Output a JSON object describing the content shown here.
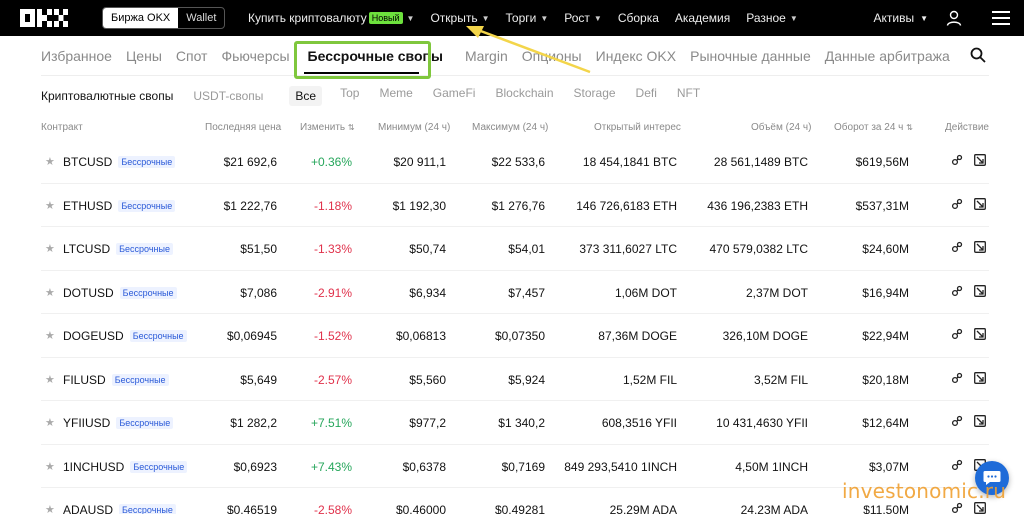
{
  "nav": {
    "logo": "OKX",
    "switch": {
      "exchange": "Биржа OKX",
      "wallet": "Wallet"
    },
    "items": [
      {
        "label": "Купить криптовалюту",
        "badge": "Новый",
        "chevron": true
      },
      {
        "label": "Открыть",
        "chevron": true
      },
      {
        "label": "Торги",
        "chevron": true
      },
      {
        "label": "Рост",
        "chevron": true
      },
      {
        "label": "Сборка",
        "chevron": false
      },
      {
        "label": "Академия",
        "chevron": false
      },
      {
        "label": "Разное",
        "chevron": true
      }
    ],
    "assets": "Активы"
  },
  "category_tabs": [
    "Избранное",
    "Цены",
    "Спот",
    "Фьючерсы",
    "Бессрочные свопы",
    "Margin",
    "Опционы",
    "Индекс OKX",
    "Рыночные данные",
    "Данные арбитража"
  ],
  "active_category": "Бессрочные свопы",
  "sub_tabs": {
    "primary": "Криптовалютные свопы",
    "secondary": "USDT-свопы",
    "filters": [
      "Все",
      "Top",
      "Meme",
      "GameFi",
      "Blockchain",
      "Storage",
      "Defi",
      "NFT"
    ],
    "active_filter": "Все"
  },
  "table": {
    "headers": {
      "contract": "Контракт",
      "last_price": "Последняя цена",
      "change": "Изменить",
      "low": "Минимум (24 ч)",
      "high": "Максимум (24 ч)",
      "oi": "Открытый интерес",
      "volume": "Объём (24 ч)",
      "turnover": "Оборот за 24 ч",
      "action": "Действие"
    },
    "sort_icon": "sort-arrows-icon",
    "tag_label": "Бессрочные",
    "rows": [
      {
        "symbol": "BTCUSD",
        "price": "$21 692,6",
        "change": "+0.36%",
        "dir": "pos",
        "low": "$20 911,1",
        "high": "$22 533,6",
        "oi": "18 454,1841 BTC",
        "volume": "28 561,1489 BTC",
        "turnover": "$619,56M"
      },
      {
        "symbol": "ETHUSD",
        "price": "$1 222,76",
        "change": "-1.18%",
        "dir": "neg",
        "low": "$1 192,30",
        "high": "$1 276,76",
        "oi": "146 726,6183 ETH",
        "volume": "436 196,2383 ETH",
        "turnover": "$537,31M"
      },
      {
        "symbol": "LTCUSD",
        "price": "$51,50",
        "change": "-1.33%",
        "dir": "neg",
        "low": "$50,74",
        "high": "$54,01",
        "oi": "373 311,6027 LTC",
        "volume": "470 579,0382 LTC",
        "turnover": "$24,60M"
      },
      {
        "symbol": "DOTUSD",
        "price": "$7,086",
        "change": "-2.91%",
        "dir": "neg",
        "low": "$6,934",
        "high": "$7,457",
        "oi": "1,06M DOT",
        "volume": "2,37M DOT",
        "turnover": "$16,94M"
      },
      {
        "symbol": "DOGEUSD",
        "price": "$0,06945",
        "change": "-1.52%",
        "dir": "neg",
        "low": "$0,06813",
        "high": "$0,07350",
        "oi": "87,36M DOGE",
        "volume": "326,10M DOGE",
        "turnover": "$22,94M"
      },
      {
        "symbol": "FILUSD",
        "price": "$5,649",
        "change": "-2.57%",
        "dir": "neg",
        "low": "$5,560",
        "high": "$5,924",
        "oi": "1,52M FIL",
        "volume": "3,52M FIL",
        "turnover": "$20,18M"
      },
      {
        "symbol": "YFIIUSD",
        "price": "$1 282,2",
        "change": "+7.51%",
        "dir": "pos",
        "low": "$977,2",
        "high": "$1 340,2",
        "oi": "608,3516 YFII",
        "volume": "10 431,4630 YFII",
        "turnover": "$12,64M"
      },
      {
        "symbol": "1INCHUSD",
        "price": "$0,6923",
        "change": "+7.43%",
        "dir": "pos",
        "low": "$0,6378",
        "high": "$0,7169",
        "oi": "849 293,5410 1INCH",
        "volume": "4,50M 1INCH",
        "turnover": "$3,07M"
      },
      {
        "symbol": "ADAUSD",
        "price": "$0,46519",
        "change": "-2.58%",
        "dir": "neg",
        "low": "$0,46000",
        "high": "$0,49281",
        "oi": "25,29M ADA",
        "volume": "24,23M ADA",
        "turnover": "$11,50M"
      }
    ]
  },
  "watermark": "investonomic.ru",
  "colors": {
    "positive": "#26a65b",
    "negative": "#e0314b",
    "highlight": "#7fc73d",
    "arrow": "#f3d54a",
    "chat": "#1e6bd8"
  }
}
